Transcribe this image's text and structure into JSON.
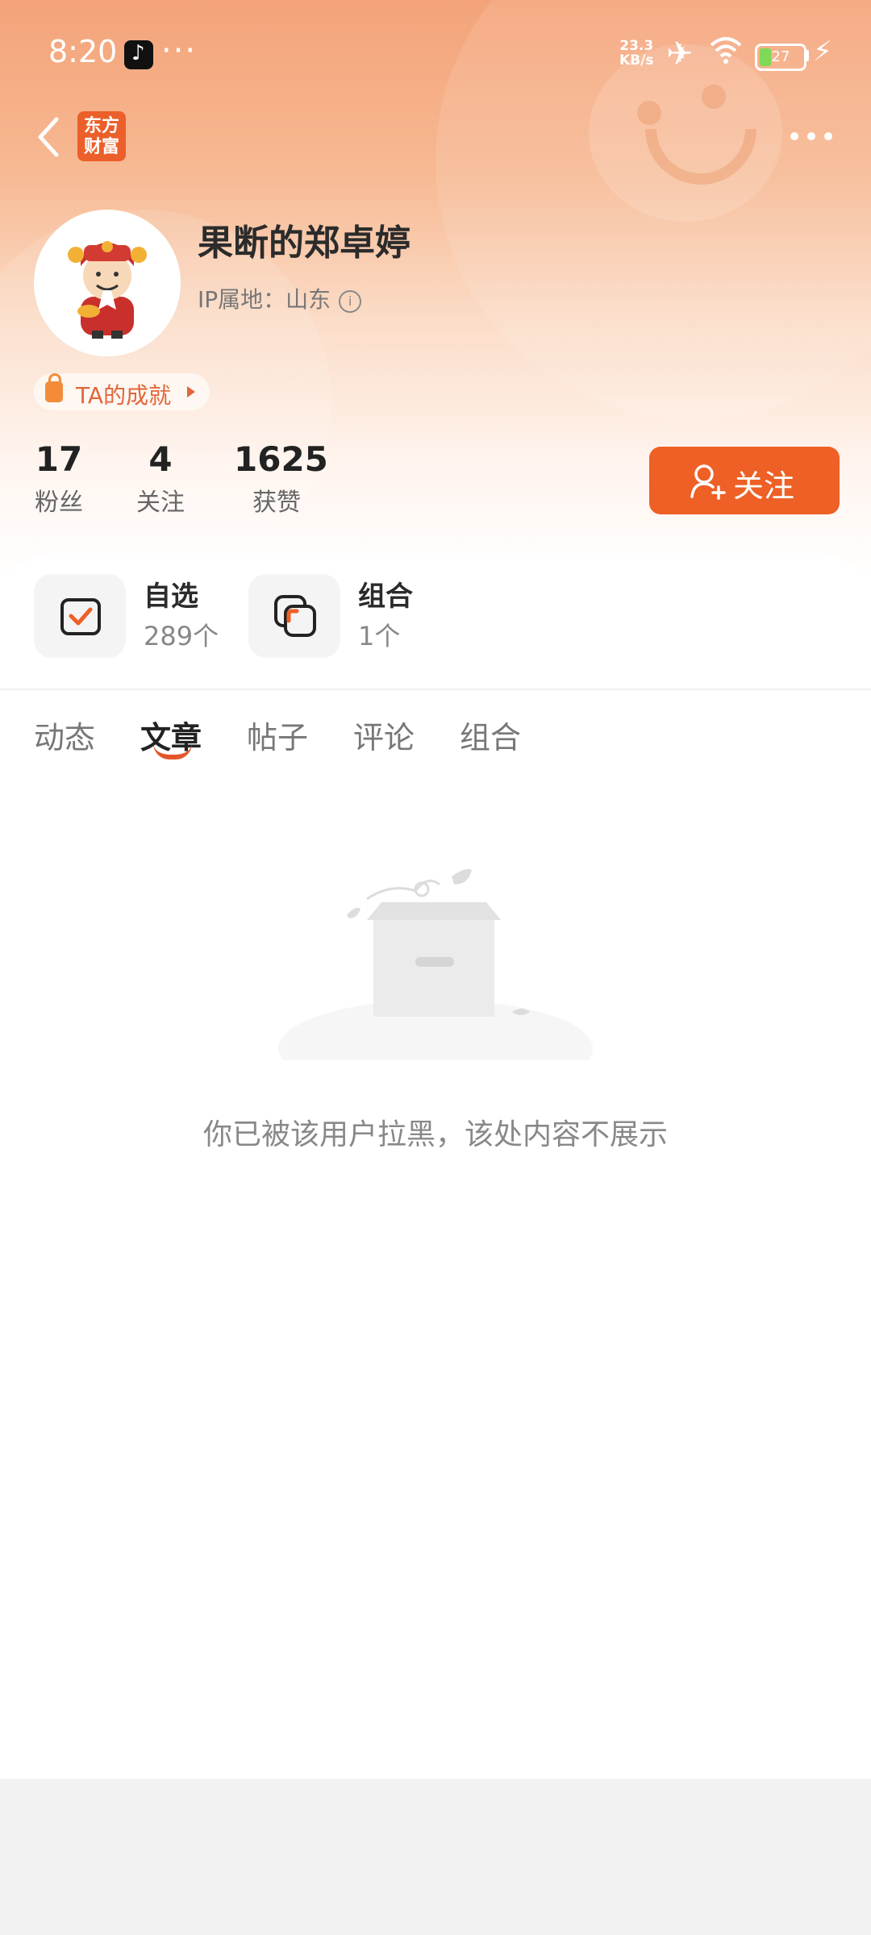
{
  "status_bar": {
    "time": "8:20",
    "speed_value": "23.3",
    "speed_unit": "KB/s",
    "battery": "27"
  },
  "header": {
    "logo_line1": "东方",
    "logo_line2": "财富"
  },
  "profile": {
    "username": "果断的郑卓婷",
    "ip_label": "IP属地：山东",
    "achievement_label": "TA的成就",
    "stats": [
      {
        "value": "17",
        "label": "粉丝"
      },
      {
        "value": "4",
        "label": "关注"
      },
      {
        "value": "1625",
        "label": "获赞"
      }
    ],
    "follow_label": "关注"
  },
  "quick_links": [
    {
      "title": "自选",
      "count": "289个"
    },
    {
      "title": "组合",
      "count": "1个"
    }
  ],
  "tabs": [
    "动态",
    "文章",
    "帖子",
    "评论",
    "组合"
  ],
  "active_tab": "文章",
  "empty_message": "你已被该用户拉黑，该处内容不展示",
  "colors": {
    "accent": "#ee6025",
    "header_gradient_top": "#f4a379",
    "tab_indicator": "#e4562a"
  }
}
